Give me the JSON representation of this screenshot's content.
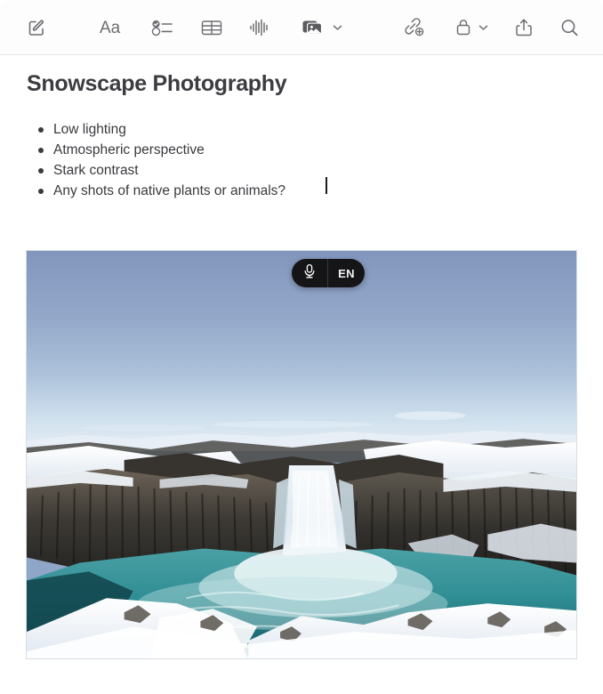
{
  "window": {
    "app": "Notes",
    "background_color": "#ffffff"
  },
  "toolbar": {
    "background_color": "#fdfdfd",
    "icon_color": "#6e6e73",
    "items": [
      {
        "name": "compose-note",
        "icon": "compose-icon",
        "label": "New Note",
        "has_chevron": false
      },
      {
        "name": "format-text",
        "icon": "format-aa-icon",
        "label": "Aa",
        "has_chevron": false
      },
      {
        "name": "checklist",
        "icon": "checklist-icon",
        "label": "Checklist",
        "has_chevron": false
      },
      {
        "name": "table",
        "icon": "table-icon",
        "label": "Table",
        "has_chevron": false
      },
      {
        "name": "audio",
        "icon": "audio-waveform-icon",
        "label": "Record Audio",
        "has_chevron": false
      },
      {
        "name": "media",
        "icon": "media-photo-icon",
        "label": "Media",
        "has_chevron": true
      },
      {
        "name": "add-link",
        "icon": "link-add-icon",
        "label": "Add Link",
        "has_chevron": false
      },
      {
        "name": "lock",
        "icon": "lock-icon",
        "label": "Lock Note",
        "has_chevron": true
      },
      {
        "name": "share",
        "icon": "share-icon",
        "label": "Share",
        "has_chevron": false
      },
      {
        "name": "search",
        "icon": "search-icon",
        "label": "Search",
        "has_chevron": false
      }
    ]
  },
  "note": {
    "title": "Snowscape Photography",
    "bullets": [
      "Low lighting",
      "Atmospheric perspective",
      "Stark contrast",
      "Any shots of native plants or animals?"
    ],
    "text_color": "#3a3a3f",
    "title_color": "#3c3c41",
    "caret_visible": true
  },
  "dictation": {
    "mic_icon": "microphone-icon",
    "language": "EN",
    "background_color": "#151517",
    "text_color": "#f2f2f2"
  },
  "attachment": {
    "name": "snowscape-waterfall-photo",
    "alt": "Winter waterfall in a basalt column canyon with snow-covered rocks and turquoise water",
    "sky_top_color": "#8ea3c6",
    "sky_horizon_color": "#cfe0ee",
    "water_color": "#2f8e94",
    "snow_color": "#f3f6fa",
    "rock_color": "#3a3a38",
    "border_color": "#d9dde4"
  }
}
